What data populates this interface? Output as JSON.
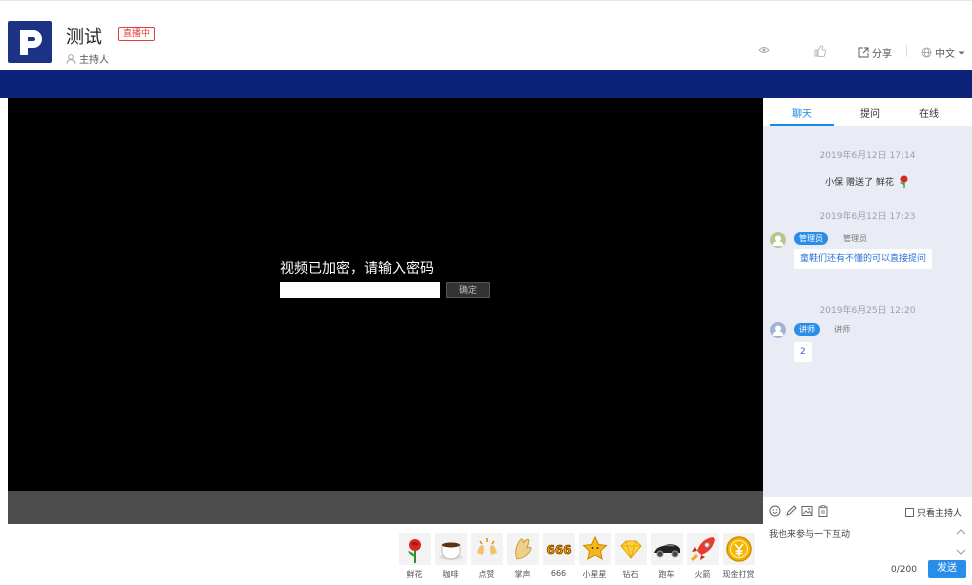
{
  "header": {
    "title": "测试",
    "live_badge": "直播中",
    "host_label": "主持人",
    "share_label": "分享",
    "language_label": "中文"
  },
  "player": {
    "password_prompt": "视频已加密，请输入密码",
    "password_value": "",
    "confirm_label": "确定"
  },
  "gifts": [
    {
      "label": "鲜花",
      "icon": "rose-icon"
    },
    {
      "label": "咖啡",
      "icon": "coffee-icon"
    },
    {
      "label": "点赞",
      "icon": "applause-icon"
    },
    {
      "label": "掌声",
      "icon": "clapping-hands-icon"
    },
    {
      "label": "666",
      "icon": "666-icon"
    },
    {
      "label": "小星星",
      "icon": "star-icon"
    },
    {
      "label": "钻石",
      "icon": "diamond-icon"
    },
    {
      "label": "跑车",
      "icon": "sports-car-icon"
    },
    {
      "label": "火箭",
      "icon": "rocket-icon"
    },
    {
      "label": "现金打赏",
      "icon": "coin-icon"
    }
  ],
  "sidebar": {
    "tabs": [
      {
        "label": "聊天",
        "active": true
      },
      {
        "label": "提问",
        "active": false
      },
      {
        "label": "在线",
        "active": false
      }
    ],
    "messages": {
      "ts1": "2019年6月12日 17:14",
      "gift_text": "小保 赠送了 鲜花",
      "ts2": "2019年6月12日 17:23",
      "admin_role": "管理员",
      "admin_name": "管理员",
      "admin_text": "童鞋们还有不懂的可以直接提问",
      "ts3": "2019年6月25日 12:20",
      "lecturer_role": "讲师",
      "lecturer_name": "讲师",
      "lecturer_text": "2"
    }
  },
  "chat_input": {
    "only_host_label": "只看主持人",
    "placeholder": "我也来参与一下互动",
    "counter": "0/200",
    "send_label": "发送"
  },
  "colors": {
    "brand_navy": "#0d237a",
    "accent_blue": "#2a8ee8",
    "live_red": "#e23c3c"
  }
}
